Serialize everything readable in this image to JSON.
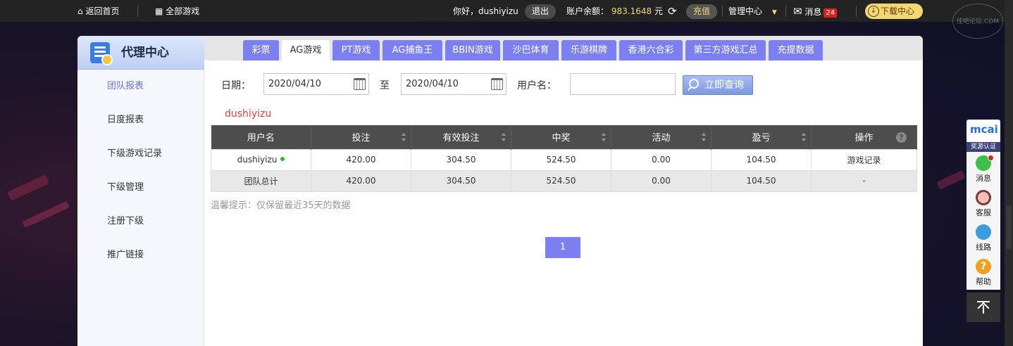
{
  "topbar": {
    "home": "返回首页",
    "all_games": "全部游戏",
    "greeting": "你好，dushiyizu",
    "logout": "退出",
    "balance_label": "账户余额：",
    "balance_value": "983.1648",
    "balance_unit": "元",
    "recharge": "充值",
    "management": "管理中心",
    "messages": "消息",
    "messages_count": "24",
    "download": "下载中心",
    "watermark": "佳吧论坛.COM"
  },
  "sidebar": {
    "title": "代理中心",
    "items": [
      {
        "label": "团队报表"
      },
      {
        "label": "日度报表"
      },
      {
        "label": "下级游戏记录"
      },
      {
        "label": "下级管理"
      },
      {
        "label": "注册下级"
      },
      {
        "label": "推广链接"
      }
    ]
  },
  "tabs": [
    {
      "label": "彩票"
    },
    {
      "label": "AG游戏"
    },
    {
      "label": "PT游戏"
    },
    {
      "label": "AG捕鱼王"
    },
    {
      "label": "BBIN游戏"
    },
    {
      "label": "沙巴体育"
    },
    {
      "label": "乐游棋牌"
    },
    {
      "label": "香港六合彩"
    },
    {
      "label": "第三方游戏汇总"
    },
    {
      "label": "充提数据"
    }
  ],
  "filter": {
    "date_label": "日期：",
    "start_date": "2020/04/10",
    "to_label": "至",
    "end_date": "2020/04/10",
    "username_label": "用户名：",
    "username_value": "",
    "query_button": "立即查询"
  },
  "current_user": "dushiyizu",
  "table": {
    "headers": [
      "用户名",
      "投注",
      "有效投注",
      "中奖",
      "活动",
      "盈亏",
      "操作"
    ],
    "rows": [
      [
        "dushiyizu",
        "420.00",
        "304.50",
        "524.50",
        "0.00",
        "104.50",
        "游戏记录"
      ],
      [
        "团队总计",
        "420.00",
        "304.50",
        "524.50",
        "0.00",
        "104.50",
        "-"
      ]
    ]
  },
  "hint": "温馨提示：仅保留最近35天的数据",
  "pagination": {
    "current": "1"
  },
  "float_bar": {
    "cert_logo": "mcai",
    "cert_label": "奖源认证",
    "message": "消息",
    "service": "客服",
    "route": "线路",
    "help": "帮助"
  },
  "colors": {
    "tab_bg": "#7b7ff0",
    "header_dark": "#4d4d4d",
    "active_side": "#6a76d8",
    "balance": "#f3d777"
  }
}
